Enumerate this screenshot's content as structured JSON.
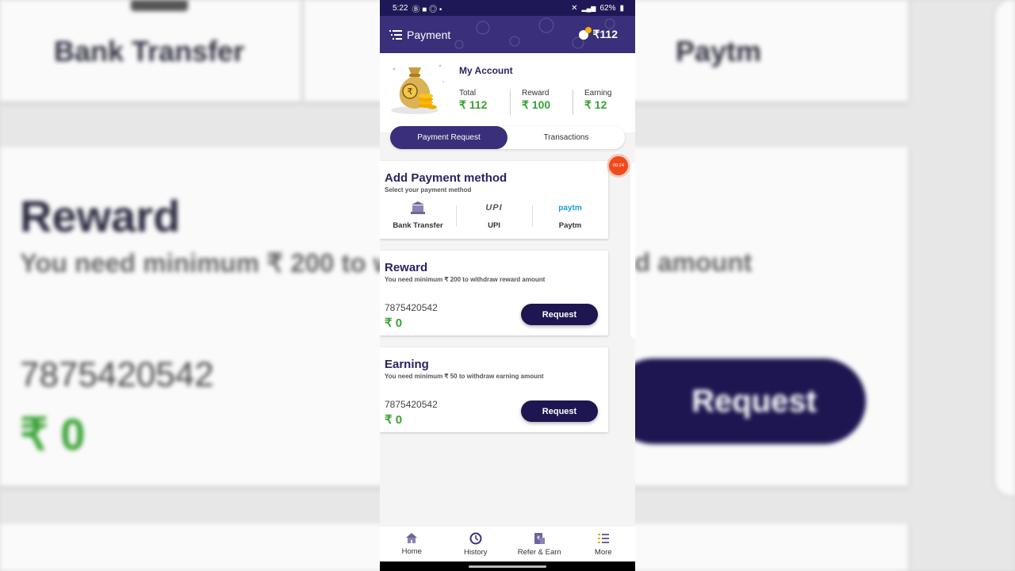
{
  "status_bar": {
    "time": "5:22",
    "battery": "62%"
  },
  "header": {
    "title": "Payment",
    "coins": "₹112"
  },
  "account": {
    "title": "My Account",
    "total_label": "Total",
    "total_value": "₹ 112",
    "reward_label": "Reward",
    "reward_value": "₹ 100",
    "earning_label": "Earning",
    "earning_value": "₹ 12"
  },
  "tabs": [
    "Payment Request",
    "Transactions"
  ],
  "payment_method": {
    "title": "Add Payment method",
    "subtitle": "Select your payment method",
    "methods": [
      {
        "label": "Bank Transfer",
        "icon": "bank-icon"
      },
      {
        "label": "UPI",
        "icon": "upi-logo",
        "logo_text": "UPI"
      },
      {
        "label": "Paytm",
        "icon": "paytm-logo",
        "logo_text": "paytm"
      }
    ]
  },
  "reward_card": {
    "title": "Reward",
    "subtitle": "You need minimum ₹ 200 to withdraw reward amount",
    "phone": "7875420542",
    "amount": "₹ 0",
    "button": "Request"
  },
  "earning_card": {
    "title": "Earning",
    "subtitle": "You need minimum ₹ 50 to withdraw earning amount",
    "phone": "7875420542",
    "amount": "₹ 0",
    "button": "Request"
  },
  "recording_timer": "00:24",
  "bottom_nav": [
    {
      "label": "Home",
      "icon": "home-icon"
    },
    {
      "label": "History",
      "icon": "history-icon"
    },
    {
      "label": "Refer & Earn",
      "icon": "refer-icon"
    },
    {
      "label": "More",
      "icon": "more-icon"
    }
  ],
  "colors": {
    "primary": "#3a2f7a",
    "dark_button": "#1d1650",
    "money_green": "#3aa335",
    "timer": "#f04a1c"
  }
}
